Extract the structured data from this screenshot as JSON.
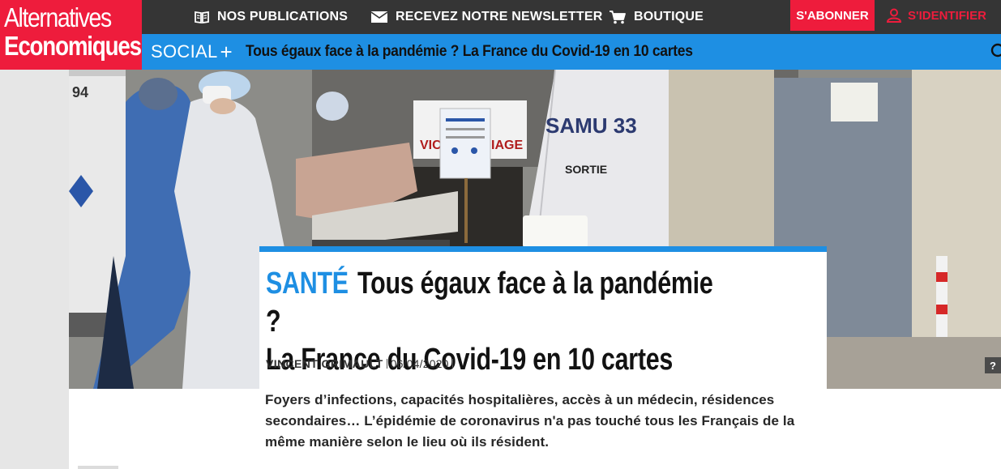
{
  "brand": {
    "line1": "Alternatives",
    "line2": "Economiques",
    "color": "#ee1c3c"
  },
  "topnav": {
    "items": [
      {
        "label": "NOS PUBLICATIONS",
        "icon": "book-icon"
      },
      {
        "label": "RECEVEZ NOTRE NEWSLETTER",
        "icon": "envelope-icon"
      },
      {
        "label": "BOUTIQUE",
        "icon": "cart-icon"
      }
    ],
    "subscribe_label": "S'ABONNER",
    "login_label": "S'IDENTIFIER",
    "login_icon": "user-icon"
  },
  "section_bar": {
    "section": "SOCIAL",
    "plus": "+",
    "title": "Tous égaux face à la pandémie ? La France du Covid-19 en 10 cartes",
    "search_icon": "search-icon",
    "color": "#1e8fe3"
  },
  "hero": {
    "ambulance_number": "94",
    "sign_left": "VICT",
    "sign_right": "IAGE",
    "tent_label": "SAMU 33",
    "tent_exit": "SORTIE",
    "caption_button": "?"
  },
  "article": {
    "kicker": "SANTÉ",
    "headline_line1": "Tous égaux face à la pandémie ?",
    "headline_line2": "La France du Covid-19 en 10 cartes",
    "author": "VINCENT GRIMAULT",
    "date": "06/04/2020",
    "lede": "Foyers d’infections, capacités hospitalières, accès à un médecin, résidences secondaires… L’épidémie de coronavirus n'a pas touché tous les Français de la même manière selon le lieu où ils résident."
  }
}
